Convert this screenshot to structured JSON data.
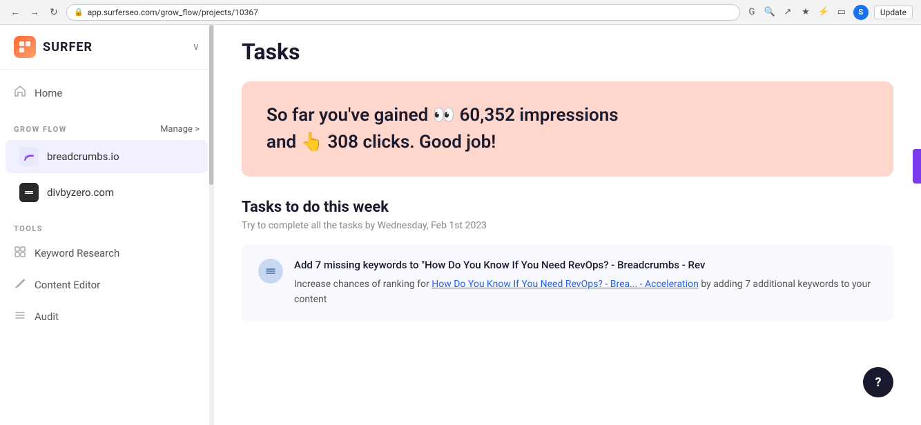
{
  "browser": {
    "url": "app.surferseo.com/grow_flow/projects/10367",
    "back_icon": "←",
    "forward_icon": "→",
    "reload_icon": "↻",
    "lock_icon": "🔒",
    "avatar_initial": "S",
    "update_label": "Update"
  },
  "sidebar": {
    "logo_text": "SURFER",
    "chevron": "∨",
    "nav_items": [
      {
        "label": "Home",
        "icon": "⌂"
      }
    ],
    "grow_flow": {
      "section_label": "GROW FLOW",
      "manage_label": "Manage",
      "manage_arrow": ">",
      "items": [
        {
          "label": "breadcrumbs.io",
          "icon": "🌿",
          "active": true
        },
        {
          "label": "divbyzero.com",
          "icon": "●",
          "dark": true
        }
      ]
    },
    "tools": {
      "section_label": "TOOLS",
      "items": [
        {
          "label": "Keyword Research",
          "icon": "⊞"
        },
        {
          "label": "Content Editor",
          "icon": "✏"
        },
        {
          "label": "Audit",
          "icon": "≡"
        }
      ]
    }
  },
  "main": {
    "page_title": "Tasks",
    "impressions_banner": {
      "text_part1": "So far you've gained",
      "eyes_emoji": "👀",
      "impressions_count": "60,352 impressions",
      "text_part2": "and",
      "hand_emoji": "👆",
      "clicks_count": "308 clicks. Good job!"
    },
    "tasks_section": {
      "title": "Tasks to do this week",
      "subtitle": "Try to complete all the tasks by Wednesday, Feb 1st 2023",
      "tasks": [
        {
          "icon": "≡",
          "main_text": "Add 7 missing keywords to \"How Do You Know If You Need RevOps? - Breadcrumbs - Rev",
          "desc_prefix": "Increase chances of ranking for ",
          "link_text": "How Do You Know If You Need RevOps? - Brea... - Acceleration",
          "desc_suffix": " by adding 7 additional keywords to your content"
        }
      ]
    }
  }
}
